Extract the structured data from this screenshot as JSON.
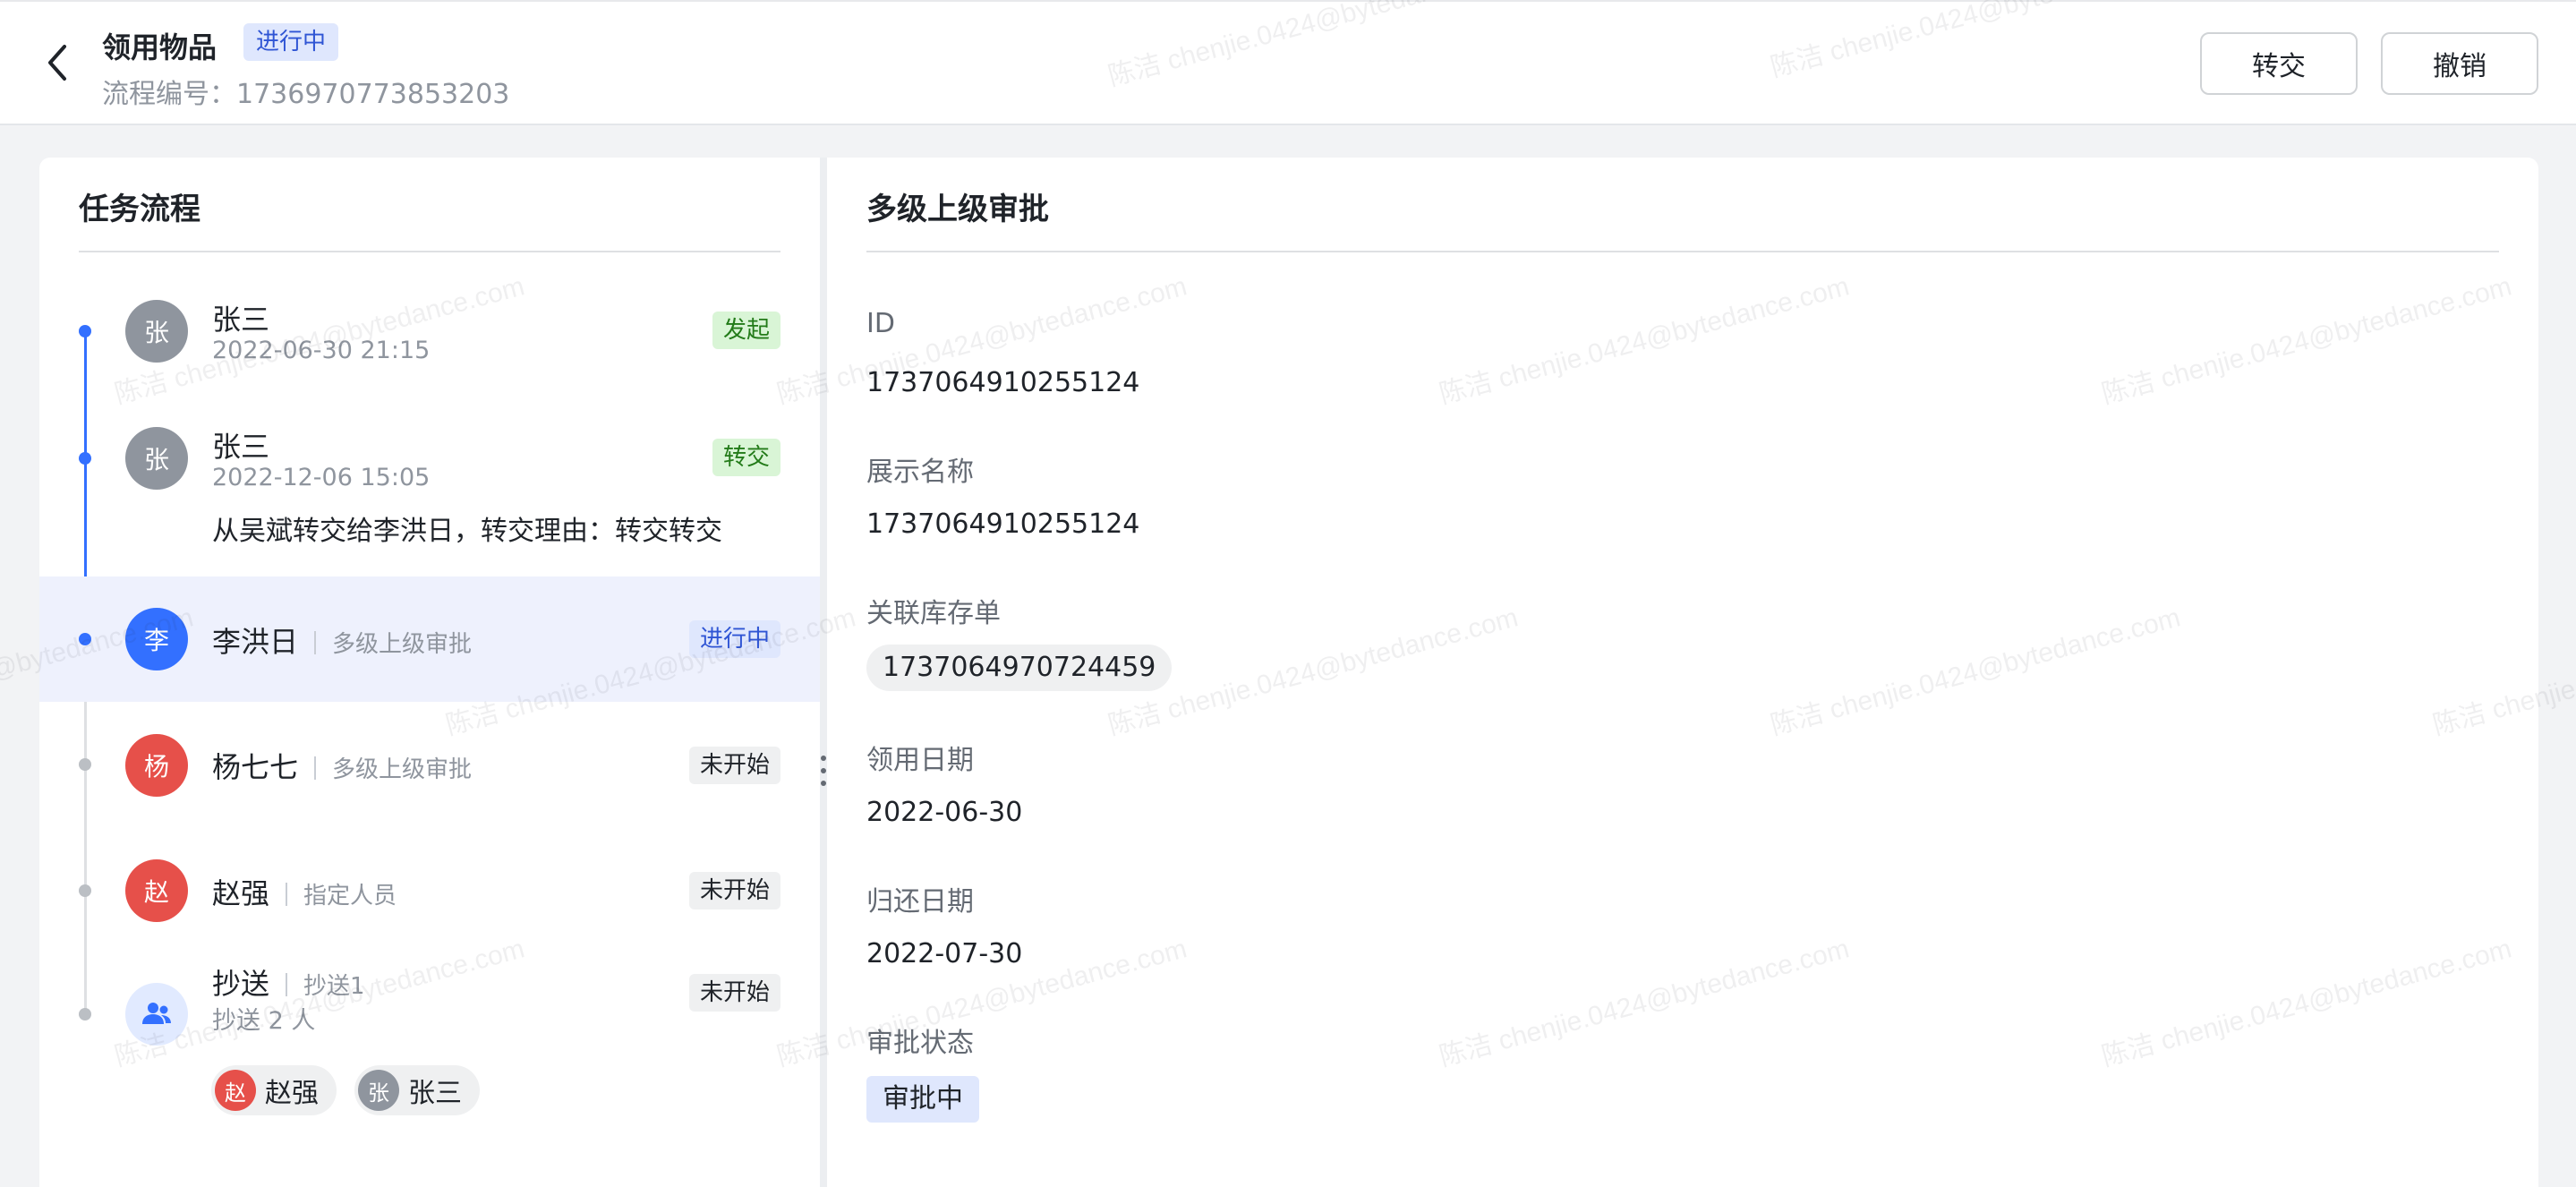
{
  "header": {
    "title": "领用物品",
    "status_badge": "进行中",
    "flow_number_label": "流程编号：",
    "flow_number": "1736970773853203",
    "buttons": {
      "transfer": "转交",
      "revoke": "撤销"
    }
  },
  "task_panel": {
    "title": "任务流程",
    "tasks": [
      {
        "avatar_char": "张",
        "avatar_color": "#8f959e",
        "name": "张三",
        "time": "2022-06-30 21:15",
        "status": "发起",
        "status_type": "green",
        "dot_color": "#3370ff"
      },
      {
        "avatar_char": "张",
        "avatar_color": "#8f959e",
        "name": "张三",
        "time": "2022-12-06 15:05",
        "note": "从吴斌转交给李洪日，转交理由：转交转交",
        "status": "转交",
        "status_type": "green",
        "dot_color": "#3370ff"
      },
      {
        "avatar_char": "李",
        "avatar_color": "#3370ff",
        "name": "李洪日",
        "sub": "多级上级审批",
        "status": "进行中",
        "status_type": "blue",
        "dot_color": "#3370ff",
        "active": true
      },
      {
        "avatar_char": "杨",
        "avatar_color": "#e6504a",
        "name": "杨七七",
        "sub": "多级上级审批",
        "status": "未开始",
        "status_type": "gray",
        "dot_color": "#bbbfc4"
      },
      {
        "avatar_char": "赵",
        "avatar_color": "#e6504a",
        "name": "赵强",
        "sub": "指定人员",
        "status": "未开始",
        "status_type": "gray",
        "dot_color": "#bbbfc4"
      },
      {
        "avatar_icon": "group-icon",
        "avatar_color": "#e1eaff",
        "name": "抄送",
        "sub": "抄送1",
        "time": "抄送 2 人",
        "status": "未开始",
        "status_type": "gray",
        "dot_color": "#bbbfc4"
      }
    ],
    "cc_people": [
      {
        "char": "赵",
        "name": "赵强",
        "color": "#e6504a"
      },
      {
        "char": "张",
        "name": "张三",
        "color": "#8f959e"
      }
    ]
  },
  "detail_panel": {
    "title": "多级上级审批",
    "fields": [
      {
        "label": "ID",
        "value": "1737064910255124",
        "kind": "text"
      },
      {
        "label": "展示名称",
        "value": "1737064910255124",
        "kind": "text"
      },
      {
        "label": "关联库存单",
        "value": "1737064970724459",
        "kind": "chip"
      },
      {
        "label": "领用日期",
        "value": "2022-06-30",
        "kind": "text"
      },
      {
        "label": "归还日期",
        "value": "2022-07-30",
        "kind": "text"
      },
      {
        "label": "审批状态",
        "value": "审批中",
        "kind": "tag"
      }
    ]
  },
  "watermark_text": "陈洁 chenjie.0424@bytedance.com"
}
